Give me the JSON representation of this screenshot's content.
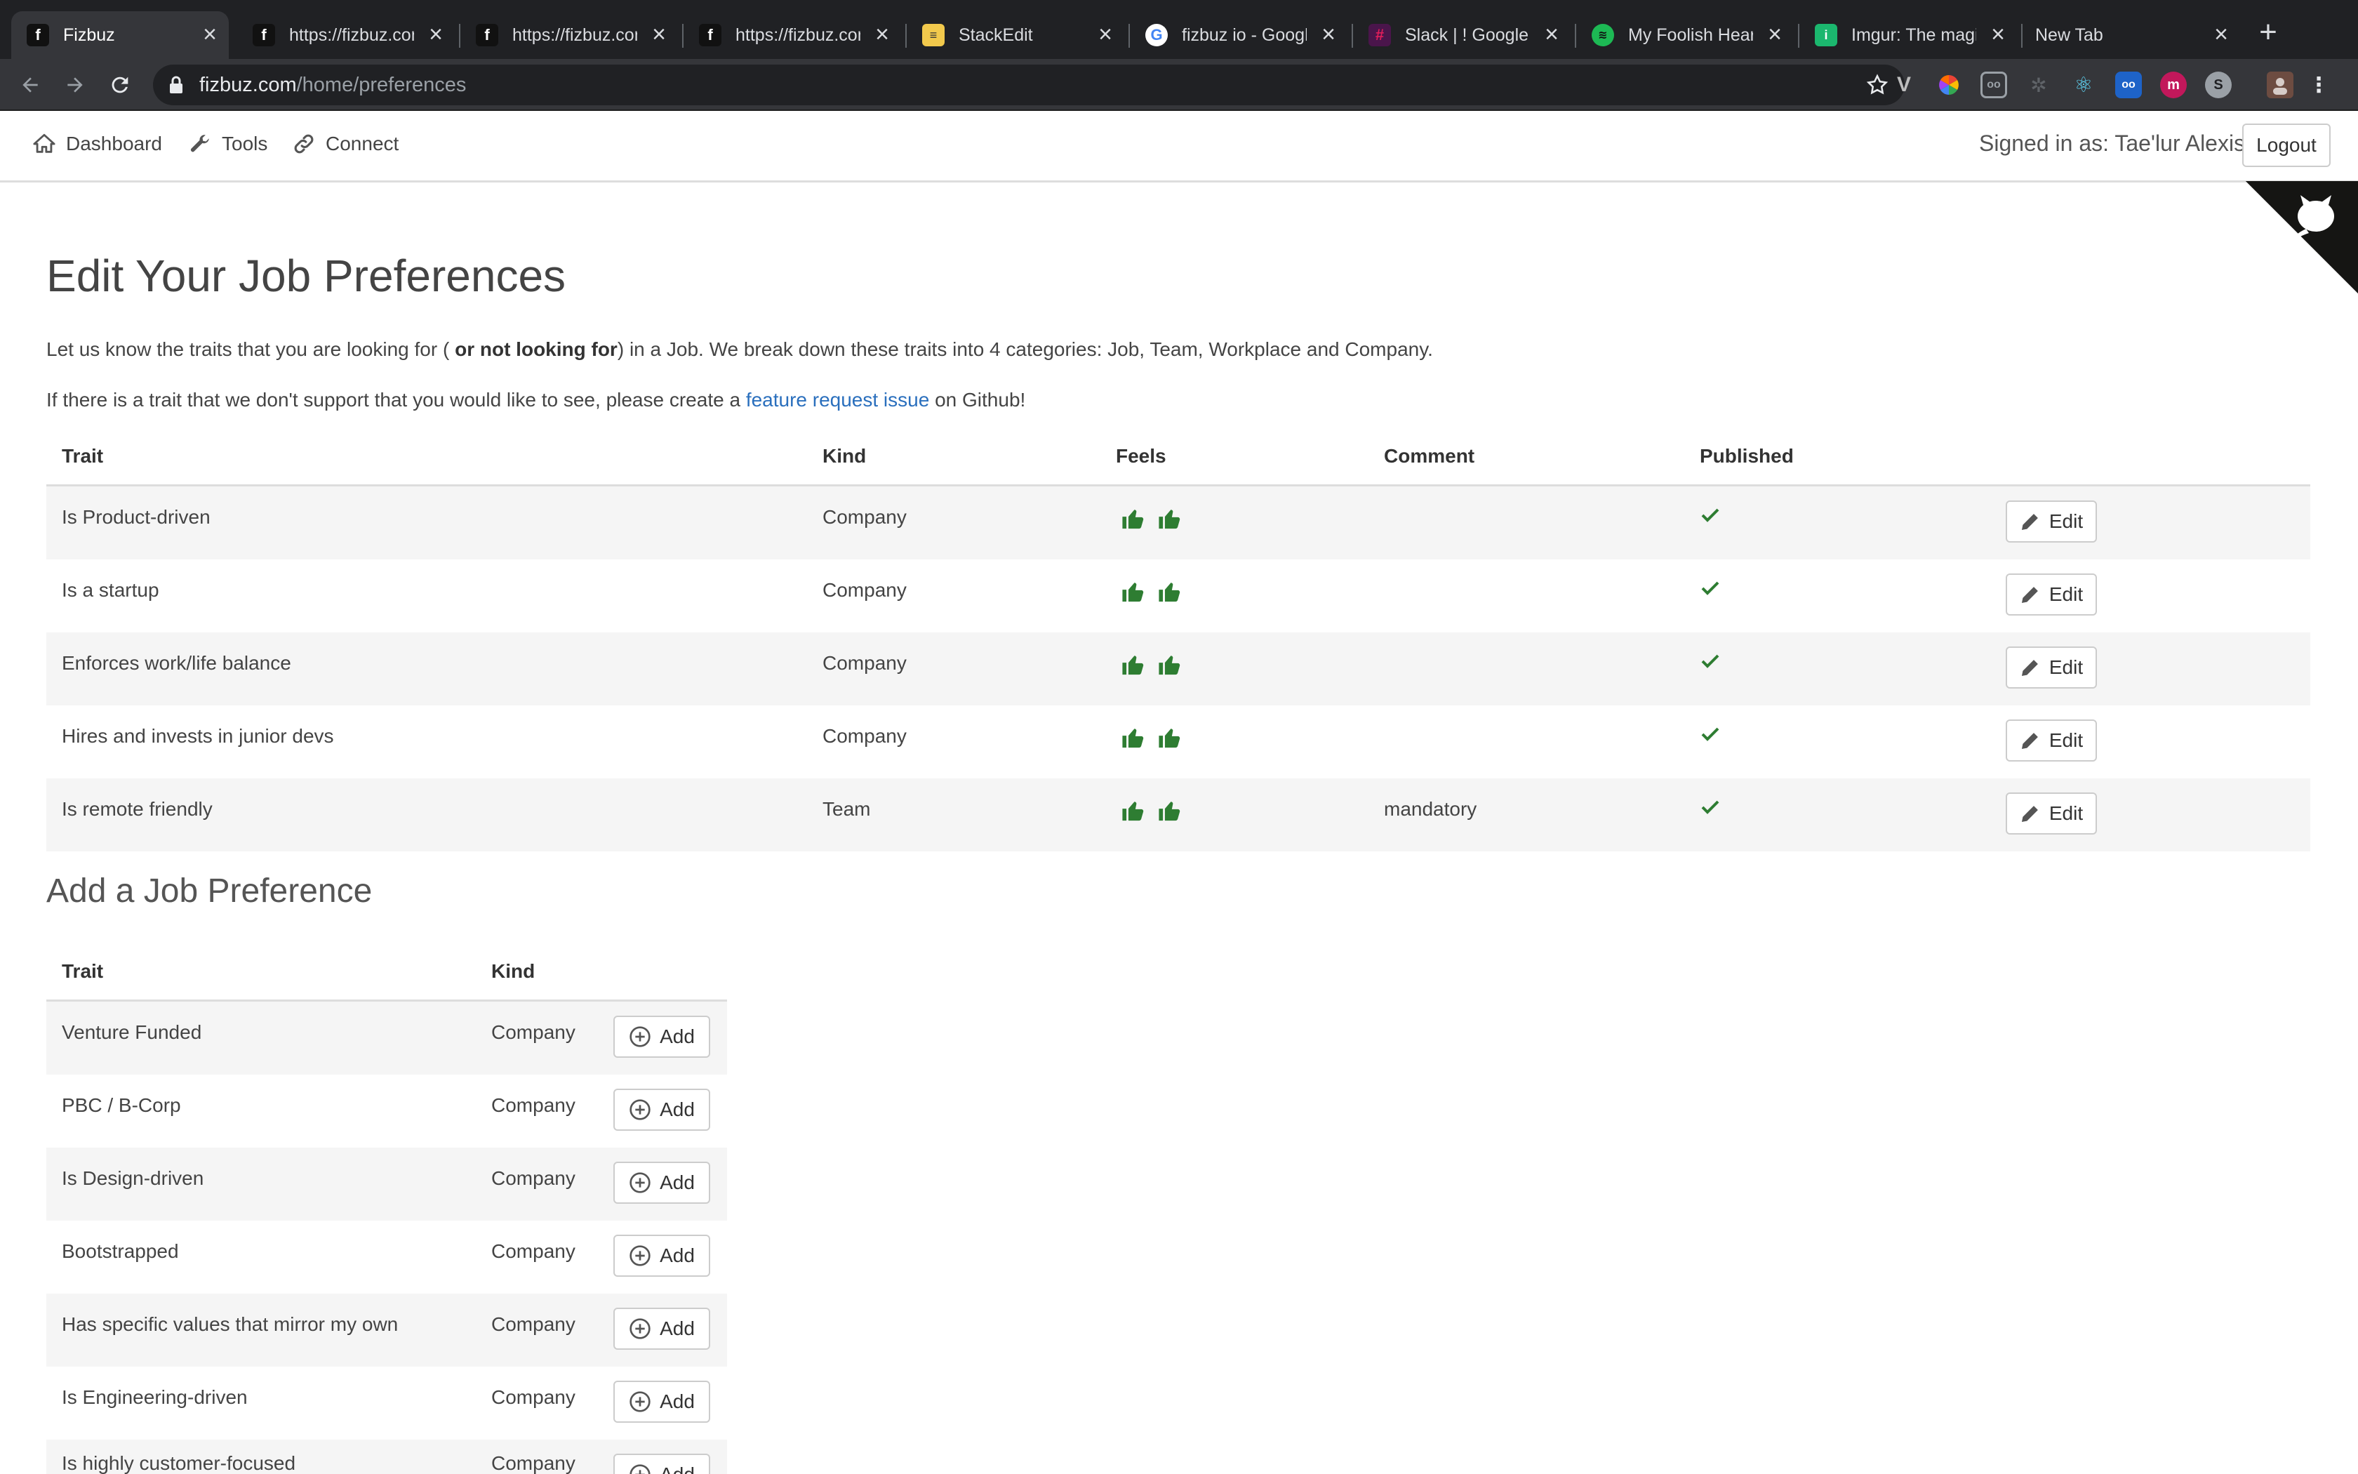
{
  "browser": {
    "tabs": [
      {
        "title": "Fizbuz",
        "icon": "fizbuz-favicon",
        "active": true
      },
      {
        "title": "https://fizbuz.com",
        "icon": "fizbuz-favicon"
      },
      {
        "title": "https://fizbuz.com",
        "icon": "fizbuz-favicon"
      },
      {
        "title": "https://fizbuz.com",
        "icon": "fizbuz-favicon"
      },
      {
        "title": "StackEdit",
        "icon": "stackedit-favicon"
      },
      {
        "title": "fizbuz io - Google",
        "icon": "google-favicon"
      },
      {
        "title": "Slack | ! Google C",
        "icon": "slack-favicon"
      },
      {
        "title": "My Foolish Heart",
        "icon": "spotify-favicon"
      },
      {
        "title": "Imgur: The magic",
        "icon": "imgur-favicon"
      },
      {
        "title": "New Tab",
        "icon": ""
      }
    ],
    "url_host": "fizbuz.com",
    "url_path": "/home/preferences",
    "extensions": [
      "vimium-icon",
      "color-wheel-icon",
      "reader-icon",
      "puzzle-icon",
      "react-devtools-icon",
      "ooo-icon",
      "m-icon",
      "s-icon",
      "profile-avatar"
    ]
  },
  "nav": {
    "dashboard": "Dashboard",
    "tools": "Tools",
    "connect": "Connect",
    "signed_in": "Signed in as: Tae'lur Alexis",
    "logout": "Logout"
  },
  "page": {
    "title": "Edit Your Job Preferences",
    "intro_1_a": "Let us know the traits that you are looking for ( ",
    "intro_1_b": "or not looking for",
    "intro_1_c": ") in a Job. We break down these traits into 4 categories: Job, Team, Workplace and Company.",
    "intro_2_a": "If there is a trait that we don't support that you would like to see, please create a ",
    "intro_2_link": "feature request issue",
    "intro_2_c": " on Github!"
  },
  "preferences_table": {
    "headers": {
      "trait": "Trait",
      "kind": "Kind",
      "feels": "Feels",
      "comment": "Comment",
      "published": "Published"
    },
    "edit_label": "Edit",
    "rows": [
      {
        "trait": "Is Product-driven",
        "kind": "Company",
        "comment": "",
        "published": true
      },
      {
        "trait": "Is a startup",
        "kind": "Company",
        "comment": "",
        "published": true
      },
      {
        "trait": "Enforces work/life balance",
        "kind": "Company",
        "comment": "",
        "published": true
      },
      {
        "trait": "Hires and invests in junior devs",
        "kind": "Company",
        "comment": "",
        "published": true
      },
      {
        "trait": "Is remote friendly",
        "kind": "Team",
        "comment": "mandatory",
        "published": true
      }
    ]
  },
  "add_section": {
    "title": "Add a Job Preference",
    "headers": {
      "trait": "Trait",
      "kind": "Kind"
    },
    "add_label": "Add",
    "rows": [
      {
        "trait": "Venture Funded",
        "kind": "Company"
      },
      {
        "trait": "PBC / B-Corp",
        "kind": "Company"
      },
      {
        "trait": "Is Design-driven",
        "kind": "Company"
      },
      {
        "trait": "Bootstrapped",
        "kind": "Company"
      },
      {
        "trait": "Has specific values that mirror my own",
        "kind": "Company"
      },
      {
        "trait": "Is Engineering-driven",
        "kind": "Company"
      },
      {
        "trait": "Is highly customer-focused",
        "kind": "Company"
      }
    ]
  },
  "colors": {
    "accent_green": "#2e7d32",
    "link": "#2a6fbd",
    "row_stripe": "#f5f5f5"
  }
}
